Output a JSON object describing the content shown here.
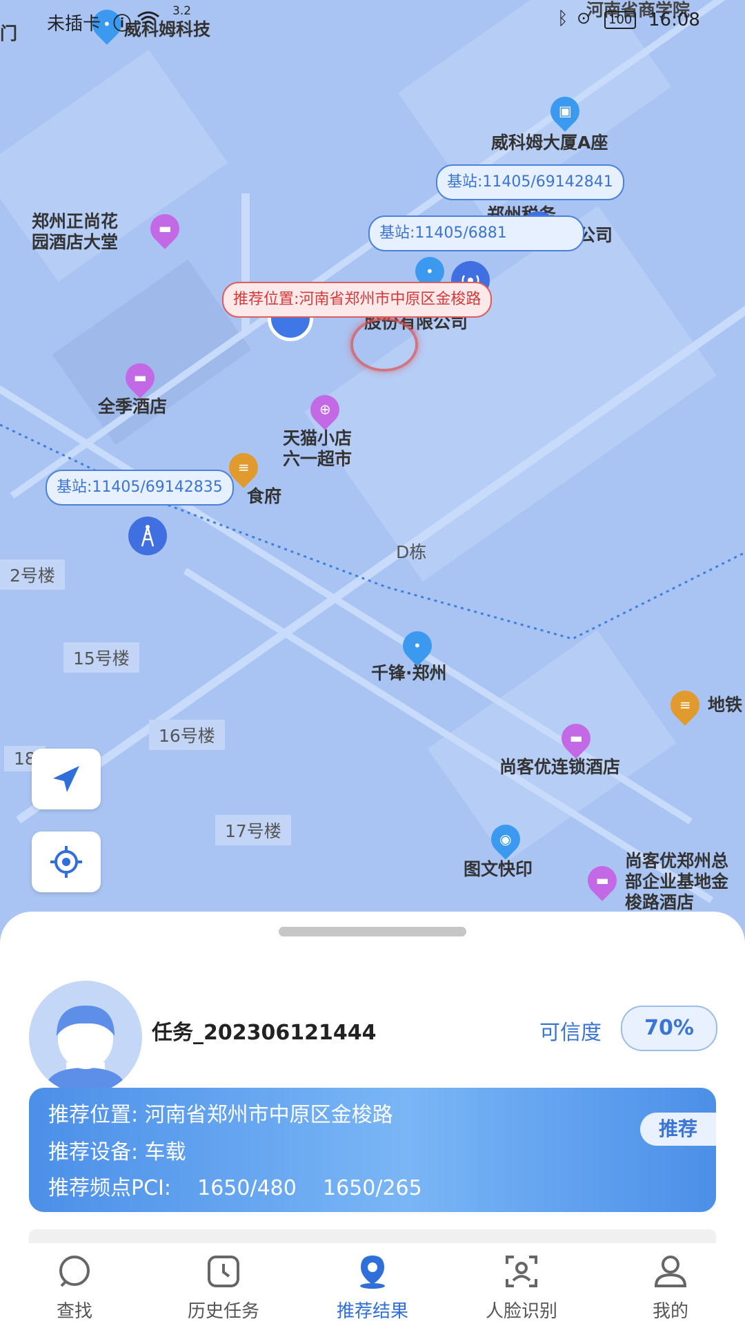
{
  "status_bar": {
    "carrier": "未插卡",
    "net_speed": "3.2",
    "battery": "100",
    "time": "16:08"
  },
  "map": {
    "station_tags": [
      "基站:11405/69142841",
      "基站:11405/6881",
      "基站:11405/69142835"
    ],
    "recommend_tag": "推荐位置:河南省郑州市中原区金梭路",
    "labels": {
      "poi1": "威科姆科技",
      "poi2": "威科姆大厦A座",
      "poi3": "郑州正尚花\n园酒店大堂",
      "poi4": "郑州税务",
      "poi4b": "公司",
      "poi5": "股份有限公司",
      "poi6": "全季酒店",
      "poi7": "天猫小店\n六一超市",
      "poi8": "食府",
      "poi9": "千锋·郑州",
      "poi10": "尚客优连锁酒店",
      "poi11": "图文快印",
      "poi12": "尚客优郑州总\n部企业基地金\n梭路酒店",
      "poi13": "地铁",
      "poi14": "河南省商学院",
      "left_edge": "门"
    },
    "buildings": {
      "d_dong": "D栋",
      "b2": "2号楼",
      "b15": "15号楼",
      "b16": "16号楼",
      "b17": "17号楼",
      "b18": "18"
    }
  },
  "sheet": {
    "task_title": "任务_202306121444",
    "credibility_label": "可信度",
    "credibility_value": "70%",
    "recommend_location": "推荐位置: 河南省郑州市中原区金梭路",
    "recommend_device": "推荐设备: 车载",
    "recommend_pci": "推荐频点PCI:    1650/480    1650/265",
    "recommend_badge": "推荐"
  },
  "tabbar": {
    "tabs": [
      {
        "label": "查找",
        "icon": "search-icon"
      },
      {
        "label": "历史任务",
        "icon": "clock-icon"
      },
      {
        "label": "推荐结果",
        "icon": "location-pin-icon"
      },
      {
        "label": "人脸识别",
        "icon": "face-scan-icon"
      },
      {
        "label": "我的",
        "icon": "user-icon"
      }
    ],
    "active_index": 2
  },
  "colors": {
    "accent": "#2f6fd9",
    "map_bg": "#a9c4f2",
    "recommend_red": "#d43a3a"
  }
}
